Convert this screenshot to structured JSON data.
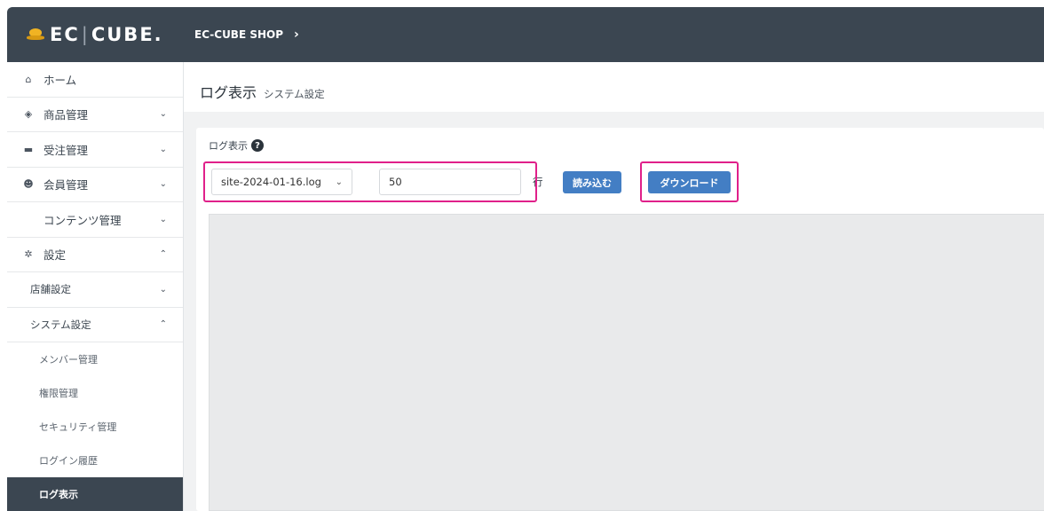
{
  "header": {
    "logo_text": "EC",
    "logo_sep": "|",
    "logo_text2": "CUBE.",
    "shop_name": "EC-CUBE SHOP",
    "shop_chevron": "›"
  },
  "sidebar": {
    "items": [
      {
        "label": "ホーム",
        "icon": "home-icon",
        "glyph": "⌂",
        "caret": ""
      },
      {
        "label": "商品管理",
        "icon": "cube-icon",
        "glyph": "◈",
        "caret": "⌄"
      },
      {
        "label": "受注管理",
        "icon": "cart-icon",
        "glyph": "▬",
        "caret": "⌄"
      },
      {
        "label": "会員管理",
        "icon": "users-icon",
        "glyph": "☻",
        "caret": "⌄"
      },
      {
        "label": "コンテンツ管理",
        "icon": "",
        "glyph": "",
        "caret": "⌄"
      },
      {
        "label": "設定",
        "icon": "gear-icon",
        "glyph": "✲",
        "caret": "⌃"
      }
    ],
    "settings_sub": [
      {
        "label": "店舗設定",
        "caret": "⌄"
      },
      {
        "label": "システム設定",
        "caret": "⌃"
      }
    ],
    "system_sub": [
      {
        "label": "メンバー管理"
      },
      {
        "label": "権限管理"
      },
      {
        "label": "セキュリティ管理"
      },
      {
        "label": "ログイン履歴"
      },
      {
        "label": "ログ表示"
      }
    ]
  },
  "page": {
    "title": "ログ表示",
    "subtitle": "システム設定"
  },
  "card": {
    "label": "ログ表示",
    "help_glyph": "?",
    "file_select_value": "site-2024-01-16.log",
    "select_arrow": "⌄",
    "lines_value": "50",
    "lines_unit": "行",
    "load_button": "読み込む",
    "download_button": "ダウンロード"
  },
  "colors": {
    "topbar": "#3b4651",
    "accent_button": "#437ec4",
    "highlight": "#e0208a"
  }
}
